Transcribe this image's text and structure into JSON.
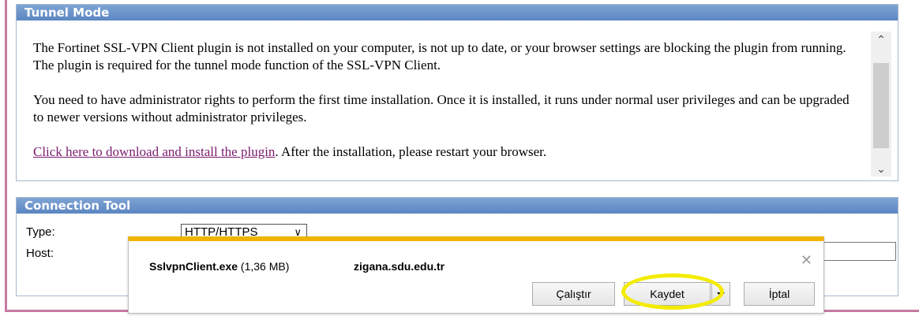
{
  "tunnel_mode": {
    "header": "Tunnel Mode",
    "paragraph_1": "The Fortinet SSL-VPN Client plugin is not installed on your computer, is not up to date, or your browser settings are blocking the plugin from running. The plugin is required for the tunnel mode function of the SSL-VPN Client.",
    "paragraph_2": "You need to have administrator rights to perform the first time installation. Once it is installed, it runs under normal user privileges and can be upgraded to newer versions without administrator privileges.",
    "download_link": "Click here to download and install the plugin",
    "after_link": ". After the installation, please restart your browser."
  },
  "connection_tool": {
    "header": "Connection Tool",
    "type_label": "Type:",
    "type_value": "HTTP/HTTPS",
    "host_label": "Host:"
  },
  "download_bar": {
    "file_name": "SslvpnClient.exe",
    "file_size": " (1,36 MB)",
    "source": "zigana.sdu.edu.tr",
    "run_label": "Çalıştır",
    "save_label": "Kaydet",
    "cancel_label": "İptal",
    "close_icon": "close-icon",
    "highlight_color": "#f3ec00"
  },
  "colors": {
    "header_blue": "#5b86c2",
    "frame_pink": "#c47aa0",
    "link_purple": "#7a1b6e",
    "bar_accent": "#f0b400"
  }
}
